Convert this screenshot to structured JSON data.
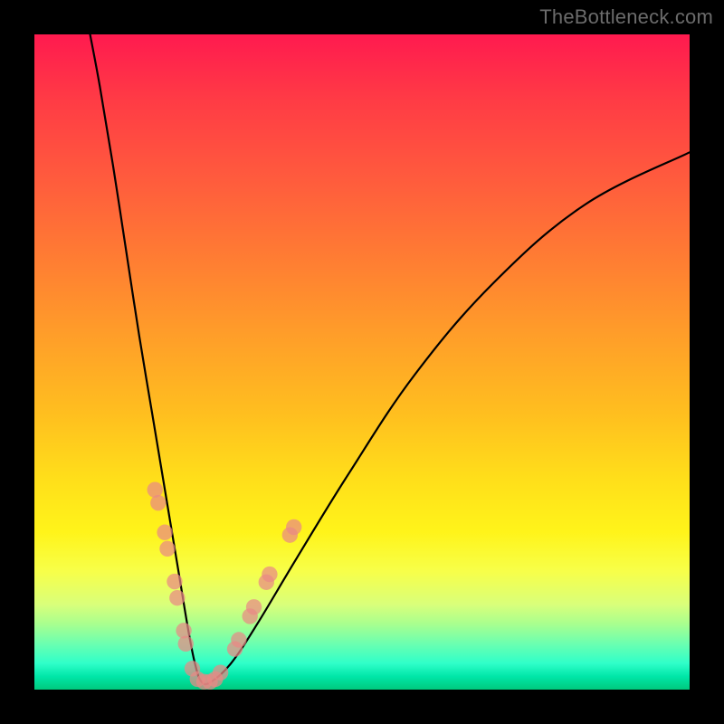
{
  "watermark": "TheBottleneck.com",
  "colors": {
    "curve_stroke": "#000000",
    "dot_fill": "#e98985",
    "frame_background": "#000000"
  },
  "chart_data": {
    "type": "line",
    "title": "",
    "xlabel": "",
    "ylabel": "",
    "xlim": [
      0,
      100
    ],
    "ylim": [
      0,
      100
    ],
    "note": "No numeric axes shown; values are relative 0–100 positions within plot rectangle; y measured from bottom.",
    "gradient_meaning": "Background encodes bottleneck severity: red (top) = high bottleneck, green (bottom) = balanced.",
    "series": [
      {
        "name": "bottleneck-curve",
        "kind": "path",
        "x": [
          8.5,
          10,
          12,
          14,
          16,
          18,
          20,
          22,
          23.5,
          24.5,
          25.5,
          27,
          30,
          34,
          40,
          48,
          58,
          70,
          84,
          100
        ],
        "y": [
          100,
          92,
          80,
          67,
          54,
          42,
          30,
          18,
          9,
          4,
          1.2,
          1.2,
          4,
          10,
          20,
          33,
          48,
          62,
          74,
          82
        ]
      }
    ],
    "dots": {
      "name": "highlighted-points",
      "comment": "Salmon circular markers clustered near the curve's trough and lower arms.",
      "points": [
        {
          "x": 18.4,
          "y": 30.5,
          "r": 1.2
        },
        {
          "x": 18.9,
          "y": 28.5,
          "r": 1.2
        },
        {
          "x": 19.9,
          "y": 24.0,
          "r": 1.2
        },
        {
          "x": 20.3,
          "y": 21.5,
          "r": 1.2
        },
        {
          "x": 21.4,
          "y": 16.5,
          "r": 1.2
        },
        {
          "x": 21.8,
          "y": 14.0,
          "r": 1.2
        },
        {
          "x": 22.8,
          "y": 9.0,
          "r": 1.2
        },
        {
          "x": 23.1,
          "y": 7.0,
          "r": 1.2
        },
        {
          "x": 24.1,
          "y": 3.2,
          "r": 1.2
        },
        {
          "x": 24.9,
          "y": 1.6,
          "r": 1.2
        },
        {
          "x": 25.9,
          "y": 1.2,
          "r": 1.2
        },
        {
          "x": 26.8,
          "y": 1.2,
          "r": 1.2
        },
        {
          "x": 27.6,
          "y": 1.6,
          "r": 1.2
        },
        {
          "x": 28.4,
          "y": 2.6,
          "r": 1.2
        },
        {
          "x": 30.6,
          "y": 6.2,
          "r": 1.2
        },
        {
          "x": 31.2,
          "y": 7.6,
          "r": 1.2
        },
        {
          "x": 32.9,
          "y": 11.2,
          "r": 1.2
        },
        {
          "x": 33.5,
          "y": 12.6,
          "r": 1.2
        },
        {
          "x": 35.4,
          "y": 16.4,
          "r": 1.2
        },
        {
          "x": 35.9,
          "y": 17.6,
          "r": 1.2
        },
        {
          "x": 39.0,
          "y": 23.6,
          "r": 1.2
        },
        {
          "x": 39.6,
          "y": 24.8,
          "r": 1.2
        }
      ]
    }
  }
}
